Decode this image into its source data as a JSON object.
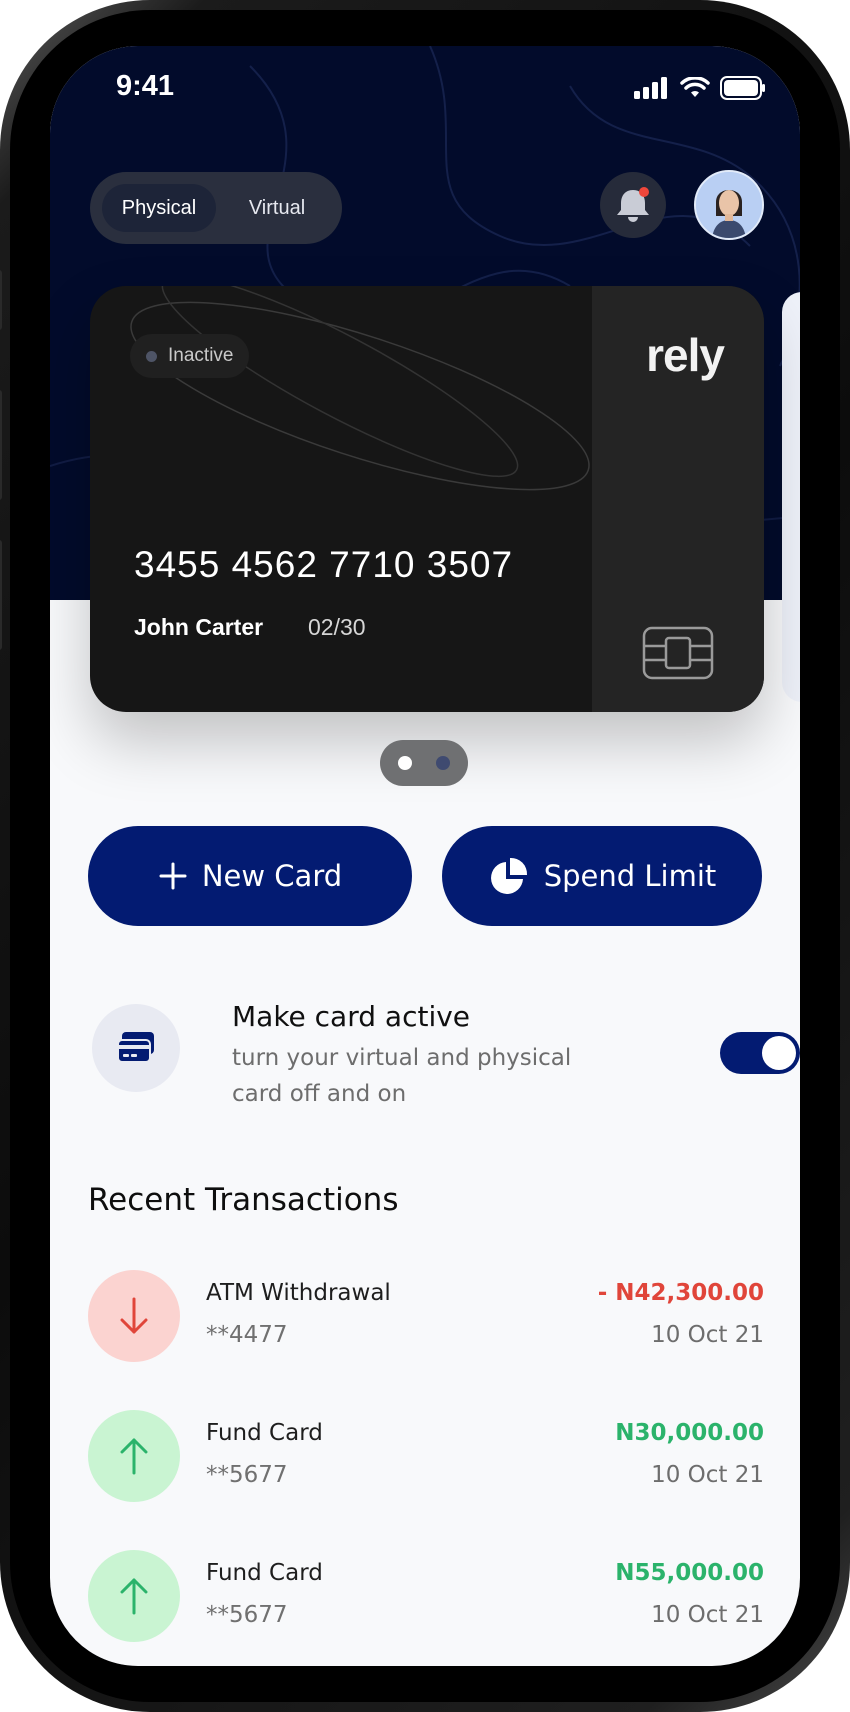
{
  "status_bar": {
    "time": "9:41"
  },
  "card_type_toggle": {
    "options": [
      "Physical",
      "Virtual"
    ],
    "selected": "Physical"
  },
  "card": {
    "status": "Inactive",
    "brand": "rely",
    "number": "3455 4562 7710 3507",
    "holder": "John Carter",
    "expiry": "02/30"
  },
  "pager": {
    "current": 1,
    "total": 2
  },
  "actions": {
    "new_card": "New Card",
    "spend_limit": "Spend Limit"
  },
  "activation": {
    "title": "Make card active",
    "description": "turn your virtual and physical card off and on",
    "enabled": true
  },
  "recent": {
    "title": "Recent Transactions",
    "items": [
      {
        "title": "ATM Withdrawal",
        "sub": "**4477",
        "amount": "- N42,300.00",
        "date": "10 Oct 21",
        "direction": "out"
      },
      {
        "title": "Fund Card",
        "sub": "**5677",
        "amount": "N30,000.00",
        "date": "10 Oct 21",
        "direction": "in"
      },
      {
        "title": "Fund Card",
        "sub": "**5677",
        "amount": "N55,000.00",
        "date": "10 Oct 21",
        "direction": "in"
      }
    ]
  },
  "colors": {
    "primary": "#031b72",
    "header": "#020b2b",
    "negative": "#e0453a",
    "positive": "#2bb36b",
    "negative_bg": "#fbd3d0",
    "positive_bg": "#c9f4d2"
  }
}
